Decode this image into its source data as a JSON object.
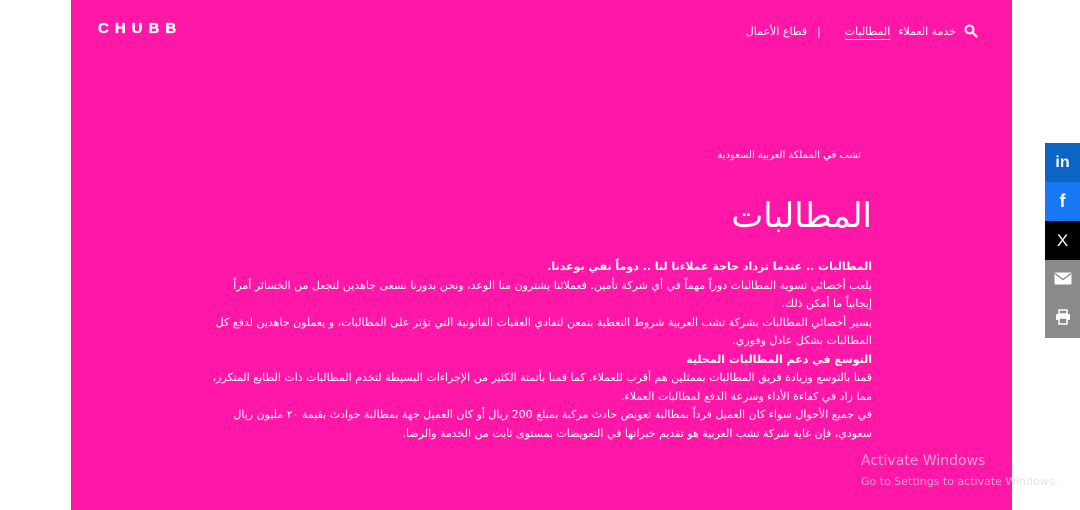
{
  "brand": {
    "logo_text": "CHUBB",
    "panel_color": "#ff17a8"
  },
  "nav": {
    "customer_service": "خدمة العملاء",
    "claims": "المطالبات",
    "separator": "|",
    "business": "قطاع الأعمال",
    "search_icon": "search-icon"
  },
  "breadcrumb": "تشب في المملكة العربية السعودية",
  "page_title": "المطالبات",
  "content": {
    "p1": "المطالبات .. عندما تزداد حاجة عملاءنا لنا .. دوماً نفي بوعدنا.",
    "p2": "يلعب أخصائي تسوية المطالبات دوراً مهماً في أي شركة تأمين. فعملائنا يشترون منا الوعد، ونحن بدورنا نسعى جاهدين لنجعل من الخسائر أمراً إيجابياً ما أمكن ذلك.",
    "p3": "يسير أخصائي المطالبات بشركة تشب العربية شروط التغطية بتمعن لتفادي العقبات القانونية التي تؤثر على المطالبات، و يعملون جاهدين لدفع كل المطالبات بشكل عادل وفوري.",
    "p4": "التوسع في دعم المطالبات المحلية",
    "p5": "قمنا بالتوسع وزيادة فريق المطالبات بممثلين هم أقرب للعملاء. كما قمنا بأتمتة الكثير من الإجراءات البسيطة لتخدم المطالبات ذات الطابع المتكرر، مما زاد في كفاءة الأداء وسرعة الدفع لمطالبات العملاء.",
    "p6": "في جميع الأحوال سواء كان العميل فرداً بمطالبة تعويض حادث مركبة بمبلغ 200 ريال أو كان العميل جهة بمطالبة حوادث بقيمة ٢٠ مليون ريال سعودي، فإن غاية شركة تشب العربية هو تقديم خبراتها في التعويضات بمستوى ثابت من الخدمة والرضا."
  },
  "share": {
    "linkedin": "in",
    "facebook": "f",
    "x": "X",
    "email_icon": "envelope-icon",
    "print_icon": "printer-icon"
  },
  "watermark": {
    "line1": "Activate Windows",
    "line2": "Go to Settings to activate Windows."
  }
}
